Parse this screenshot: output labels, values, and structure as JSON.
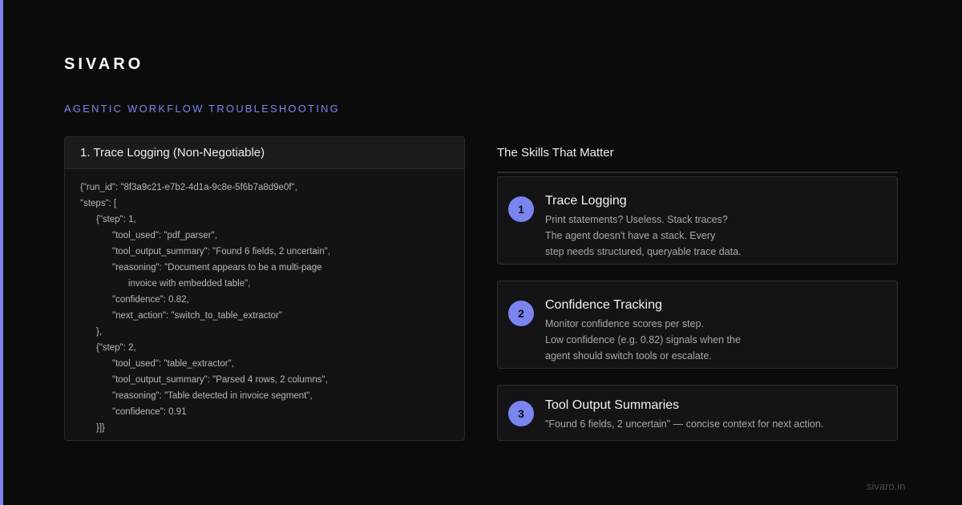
{
  "brand": "SIVARO",
  "eyebrow": "AGENTIC WORKFLOW TROUBLESHOOTING",
  "code_panel": {
    "title": "1. Trace Logging (Non-Negotiable)",
    "lines": [
      "{\"run_id\": \"8f3a9c21-e7b2-4d1a-9c8e-5f6b7a8d9e0f\",",
      "\"steps\": [",
      "{\"step\": 1,",
      "\"tool_used\": \"pdf_parser\",",
      "\"tool_output_summary\": \"Found 6 fields, 2 uncertain\",",
      "\"reasoning\": \"Document appears to be a multi-page",
      "invoice with embedded table\",",
      "\"confidence\": 0.82,",
      "\"next_action\": \"switch_to_table_extractor\"",
      "},",
      "{\"step\": 2,",
      "\"tool_used\": \"table_extractor\",",
      "\"tool_output_summary\": \"Parsed 4 rows, 2 columns\",",
      "\"reasoning\": \"Table detected in invoice segment\",",
      "\"confidence\": 0.91",
      "}]}"
    ]
  },
  "skills": {
    "title": "The Skills That Matter",
    "cards": [
      {
        "number": "1",
        "title": "Trace Logging",
        "lines": [
          "Print statements? Useless. Stack traces?",
          "The agent doesn't have a stack. Every",
          "step needs structured, queryable trace data."
        ]
      },
      {
        "number": "2",
        "title": "Confidence Tracking",
        "lines": [
          "Monitor confidence scores per step.",
          "Low confidence (e.g. 0.82) signals when the",
          "agent should switch tools or escalate."
        ]
      },
      {
        "number": "3",
        "title": "Tool Output Summaries",
        "lines": [
          "\"Found 6 fields, 2 uncertain\" — concise context for next action."
        ]
      }
    ]
  },
  "footer": "sivaro.in",
  "colors": {
    "accent": "#7b85f0",
    "background": "#0b0b0b",
    "panel": "#131315"
  }
}
